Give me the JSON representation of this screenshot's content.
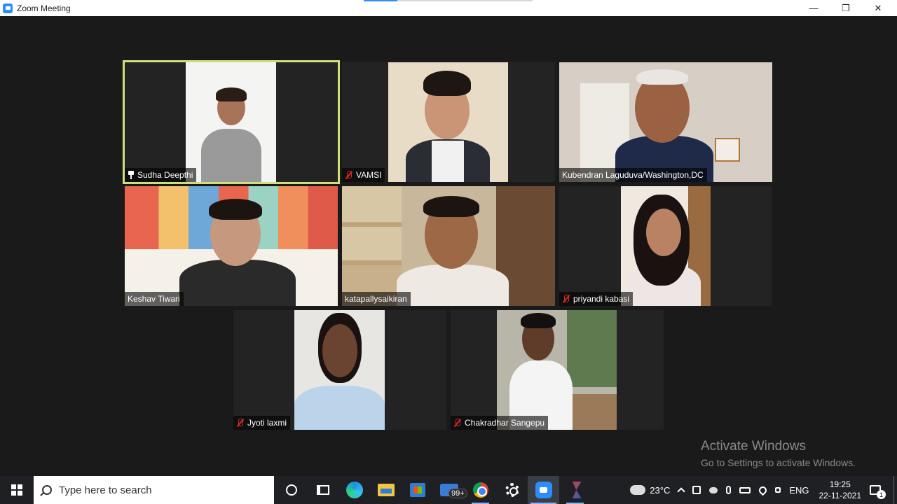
{
  "window": {
    "title": "Zoom Meeting",
    "minimize": "—",
    "restore": "❐",
    "close": "✕"
  },
  "participants": [
    {
      "name": "Sudha Deepthi",
      "muted": false,
      "pinned": true,
      "active_speaker": true
    },
    {
      "name": "VAMSI",
      "muted": true,
      "pinned": false,
      "active_speaker": false
    },
    {
      "name": "Kubendran Laguduva/Washington,DC",
      "muted": false,
      "pinned": false,
      "active_speaker": false
    },
    {
      "name": "Keshav Tiwari",
      "muted": false,
      "pinned": false,
      "active_speaker": false
    },
    {
      "name": "katapallysaikiran",
      "muted": false,
      "pinned": false,
      "active_speaker": false
    },
    {
      "name": "priyandi kabasi",
      "muted": true,
      "pinned": false,
      "active_speaker": false
    },
    {
      "name": "Jyoti laxmi",
      "muted": true,
      "pinned": false,
      "active_speaker": false
    },
    {
      "name": "Chakradhar Sangepu",
      "muted": true,
      "pinned": false,
      "active_speaker": false
    }
  ],
  "watermark": {
    "line1": "Activate Windows",
    "line2": "Go to Settings to activate Windows."
  },
  "taskbar": {
    "search_placeholder": "Type here to search",
    "mail_badge": "99+",
    "weather": "23°C",
    "language": "ENG",
    "time": "19:25",
    "date": "22-11-2021",
    "notification_count": "1"
  },
  "colors": {
    "active_speaker_border": "#cfe07a",
    "muted_icon": "#e02828",
    "zoom_blue": "#2d8cff"
  }
}
